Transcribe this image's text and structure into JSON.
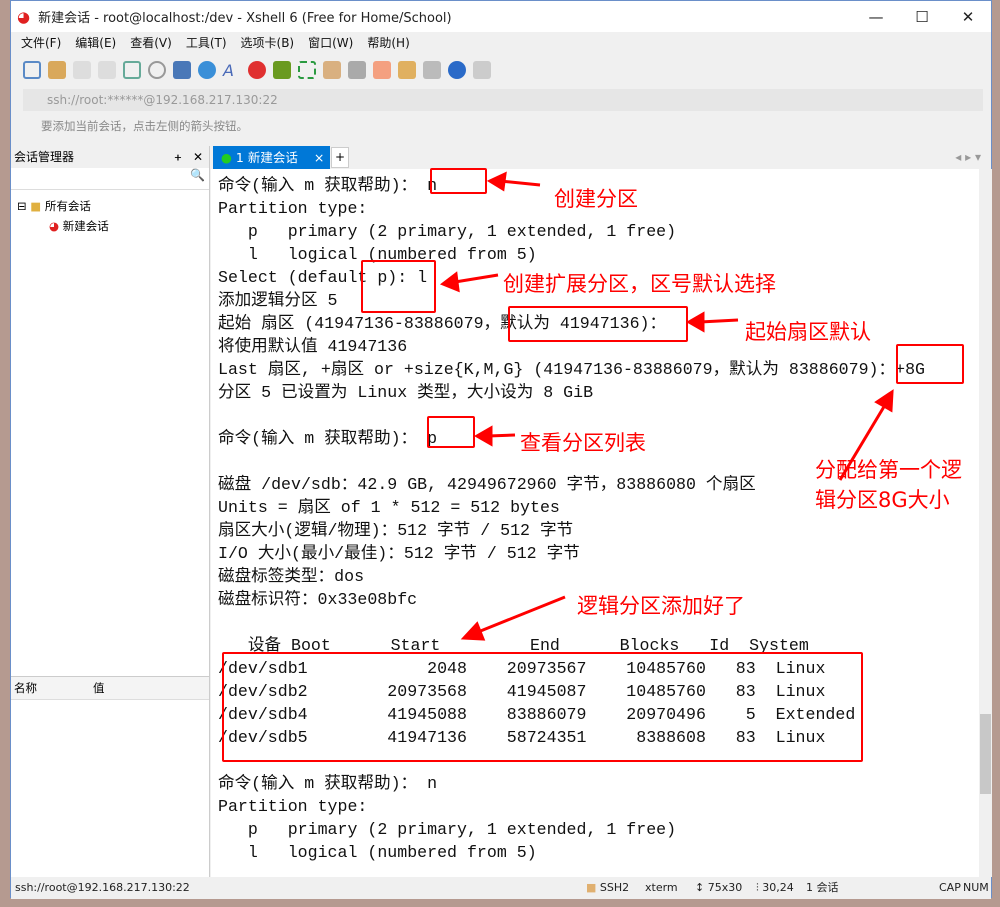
{
  "window": {
    "title": "新建会话 - root@localhost:/dev - Xshell 6 (Free for Home/School)",
    "min": "—",
    "max": "☐",
    "close": "✕"
  },
  "menu": [
    "文件(F)",
    "编辑(E)",
    "查看(V)",
    "工具(T)",
    "选项卡(B)",
    "窗口(W)",
    "帮助(H)"
  ],
  "address": "ssh://root:******@192.168.217.130:22",
  "hint": "要添加当前会话，点击左侧的箭头按钮。",
  "session_manager": {
    "title": "会话管理器",
    "pin": "ᚐ",
    "close": "✕",
    "tree_root": "所有会话",
    "tree_child": "新建会话",
    "col_name": "名称",
    "col_value": "值"
  },
  "tab": {
    "label": "1 新建会话",
    "close": "×",
    "add": "+"
  },
  "terminal_lines": "命令(输入 m 获取帮助)： n\nPartition type:\n   p   primary (2 primary, 1 extended, 1 free)\n   l   logical (numbered from 5)\nSelect (default p): l\n添加逻辑分区 5\n起始 扇区 (41947136-83886079，默认为 41947136)：\n将使用默认值 41947136\nLast 扇区, +扇区 or +size{K,M,G} (41947136-83886079，默认为 83886079)：+8G\n分区 5 已设置为 Linux 类型，大小设为 8 GiB\n\n命令(输入 m 获取帮助)： p\n\n磁盘 /dev/sdb：42.9 GB, 42949672960 字节，83886080 个扇区\nUnits = 扇区 of 1 * 512 = 512 bytes\n扇区大小(逻辑/物理)：512 字节 / 512 字节\nI/O 大小(最小/最佳)：512 字节 / 512 字节\n磁盘标签类型：dos\n磁盘标识符：0x33e08bfc\n\n   设备 Boot      Start         End      Blocks   Id  System\n/dev/sdb1            2048    20973567    10485760   83  Linux\n/dev/sdb2        20973568    41945087    10485760   83  Linux\n/dev/sdb4        41945088    83886079    20970496    5  Extended\n/dev/sdb5        41947136    58724351     8388608   83  Linux\n\n命令(输入 m 获取帮助)： n\nPartition type:\n   p   primary (2 primary, 1 extended, 1 free)\n   l   logical (numbered from 5)",
  "annotations": {
    "a1": "创建分区",
    "a2": "创建扩展分区，区号默认选择",
    "a3": "起始扇区默认",
    "a4": "查看分区列表",
    "a5": "分配给第一个逻\n辑分区8G大小",
    "a6": "逻辑分区添加好了"
  },
  "status": {
    "connection": "ssh://root@192.168.217.130:22",
    "protocol": "SSH2",
    "term": "xterm",
    "size": "75x30",
    "cursor": "30,24",
    "sessions": "1 会话",
    "cap": "CAP",
    "num": "NUM"
  },
  "colors": {
    "accent": "#0078d7",
    "annotation": "#ff0000"
  }
}
